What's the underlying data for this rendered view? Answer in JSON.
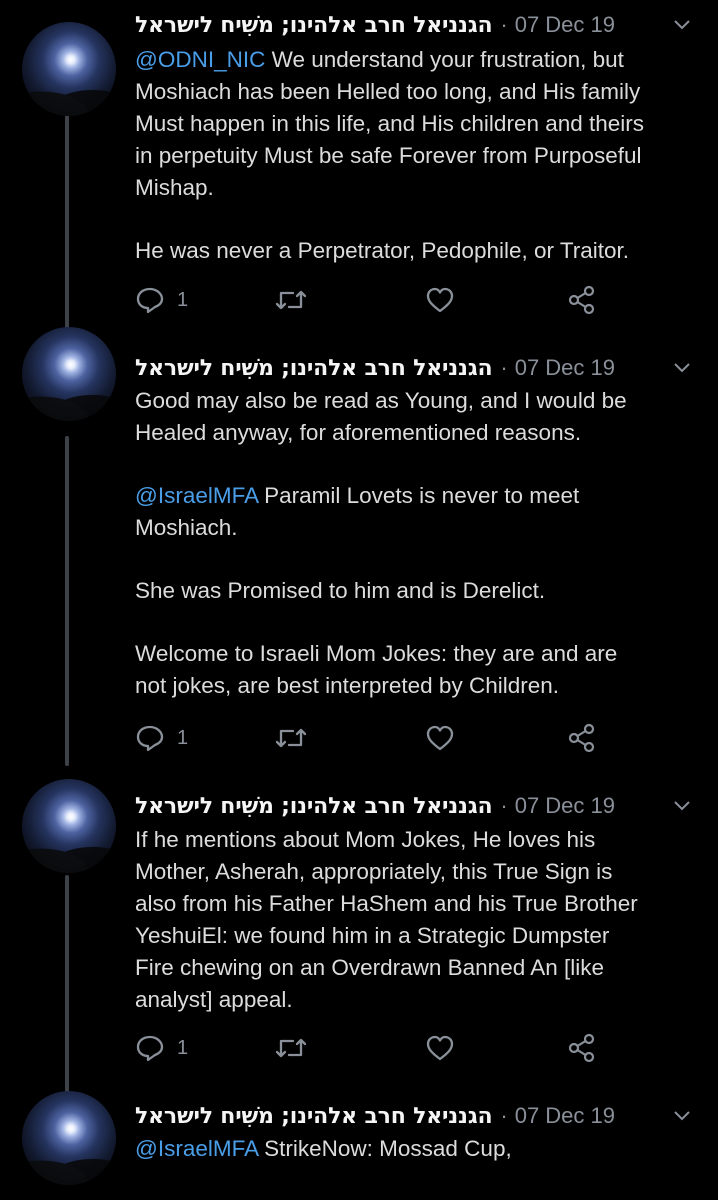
{
  "author": {
    "display_name": "הגנניאל חרב אלהינו; מֹשִיח לישראל",
    "separator": "·",
    "date": "07 Dec 19"
  },
  "icons": {
    "reply": "reply-icon",
    "retweet": "retweet-icon",
    "like": "heart-icon",
    "share": "share-icon",
    "menu": "chevron-down-icon"
  },
  "colors": {
    "background": "#000000",
    "mention": "#4a9ee8",
    "muted": "#8a9099",
    "thread_line": "#3d4248"
  },
  "tweets": [
    {
      "paragraphs": [
        {
          "mention": "@ODNI_NIC",
          "text": " We understand your frustration, but\nMoshiach has been Helled too long, and His family\nMust happen in this life, and His children and theirs\nin perpetuity Must be safe Forever from Purposeful\nMishap."
        },
        {
          "mention": "",
          "text": "He was never a Perpetrator, Pedophile, or Traitor."
        }
      ],
      "reply_count": "1"
    },
    {
      "paragraphs": [
        {
          "mention": "",
          "text": "Good may also be read as Young, and I would be\nHealed anyway, for aforementioned reasons."
        },
        {
          "mention": "@IsraelMFA",
          "text": " Paramil Lovets is never to meet\nMoshiach."
        },
        {
          "mention": "",
          "text": "She was Promised to him and is Derelict."
        },
        {
          "mention": "",
          "text": "Welcome to Israeli Mom Jokes: they are and are\nnot jokes, are best interpreted by Children."
        }
      ],
      "reply_count": "1"
    },
    {
      "paragraphs": [
        {
          "mention": "",
          "text": "If he mentions about Mom Jokes, He loves his\nMother, Asherah, appropriately, this True Sign is\nalso from his Father HaShem and his True Brother\nYeshuiEl: we found him in a Strategic Dumpster\nFire chewing on an Overdrawn Banned An [like\nanalyst] appeal."
        }
      ],
      "reply_count": "1"
    },
    {
      "paragraphs": [
        {
          "mention": "@IsraelMFA",
          "text": " StrikeNow: Mossad Cup,"
        }
      ],
      "reply_count": ""
    }
  ]
}
